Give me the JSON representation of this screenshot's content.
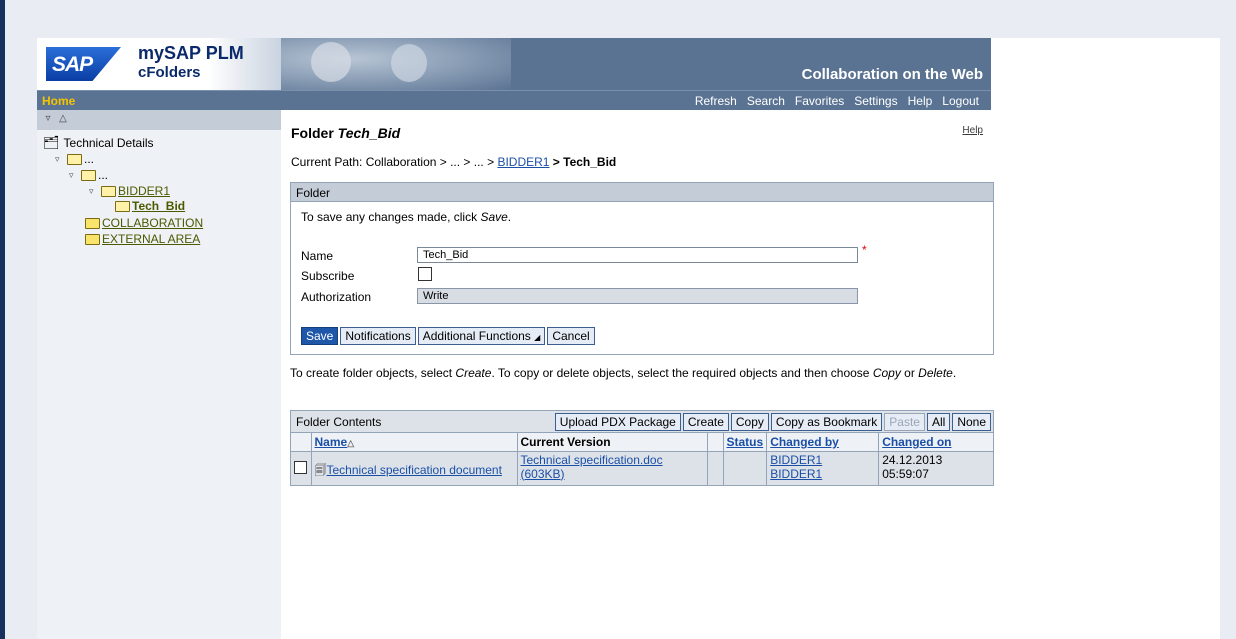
{
  "header": {
    "brand": "SAP",
    "product": "mySAP PLM",
    "module": "cFolders",
    "tagline": "Collaboration on the Web"
  },
  "nav": {
    "home": "Home",
    "links": [
      "Refresh",
      "Search",
      "Favorites",
      "Settings",
      "Help",
      "Logout"
    ]
  },
  "tree": {
    "root": "Technical Details",
    "items": [
      "...",
      "...",
      "BIDDER1",
      "Tech_Bid",
      "COLLABORATION",
      "EXTERNAL AREA"
    ]
  },
  "page": {
    "title_prefix": "Folder ",
    "title_name": "Tech_Bid",
    "help": "Help",
    "path_prefix": "Current Path:  Collaboration > ... > ... > ",
    "path_link": "BIDDER1",
    "path_suffix": " > Tech_Bid"
  },
  "folder_panel": {
    "title": "Folder",
    "hint_prefix": "To save any changes made, click ",
    "hint_emph": "Save",
    "hint_suffix": ".",
    "name_label": "Name",
    "name_value": "Tech_Bid",
    "required_mark": "*",
    "subscribe_label": "Subscribe",
    "auth_label": "Authorization",
    "auth_value": "Write",
    "buttons": {
      "save": "Save",
      "notifications": "Notifications",
      "additional": "Additional Functions",
      "cancel": "Cancel"
    }
  },
  "create_hint": {
    "p1": "To create folder objects, select ",
    "e1": "Create",
    "p2": ". To copy or delete objects, select the required objects and then choose ",
    "e2": "Copy",
    "p3": " or ",
    "e3": "Delete",
    "p4": "."
  },
  "contents": {
    "title": "Folder Contents",
    "buttons": {
      "upload": "Upload PDX Package",
      "create": "Create",
      "copy": "Copy",
      "copy_bookmark": "Copy as Bookmark",
      "paste": "Paste",
      "all": "All",
      "none": "None"
    },
    "columns": [
      "Name",
      "Current Version",
      "",
      "Status",
      "Changed by",
      "Changed on"
    ],
    "rows": [
      {
        "name": "Technical specification document",
        "version": "Technical specification.doc (603KB)",
        "status": "",
        "changed_by_1": "BIDDER1",
        "changed_by_2": "BIDDER1",
        "date": "24.12.2013",
        "time": "05:59:07"
      }
    ]
  }
}
